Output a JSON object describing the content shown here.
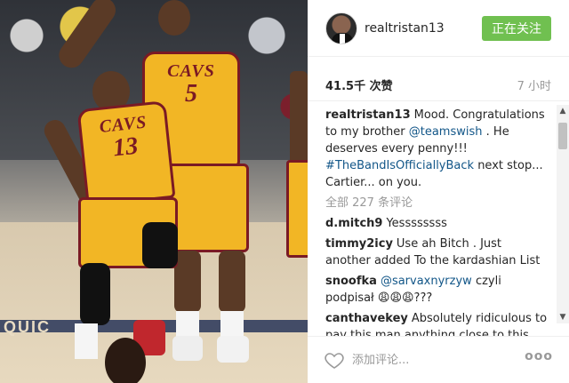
{
  "post": {
    "username": "realtristan13",
    "follow_label": "正在关注",
    "likes": "41.5千 次赞",
    "time": "7 小时"
  },
  "photo": {
    "jersey_left": {
      "team": "CAVS",
      "number": "13"
    },
    "jersey_right": {
      "team": "CAVS",
      "number": "5"
    },
    "court_text": "QUIC"
  },
  "caption": {
    "author": "realtristan13",
    "text_1": "Mood. Congratulations to my brother ",
    "mention": "@teamswish",
    "text_2": " . He deserves every penny!!! ",
    "hashtag": "#TheBandIsOfficiallyBack",
    "text_3": " next stop... Cartier... on you."
  },
  "comments_header": "全部 227 条评论",
  "comments": [
    {
      "author": "d.mitch9",
      "text": "Yessssssss"
    },
    {
      "author": "timmy2icy",
      "text": "Use ah Bitch . Just another added To the kardashian List"
    },
    {
      "author": "snoofka",
      "mention": "@sarvaxnyrzyw",
      "text": " czyli podpisał 😩😩😩???"
    },
    {
      "author": "canthavekey",
      "text": "Absolutely ridiculous to pay this man anything close to this amount. Weak minded and undisciplined and incredibly inconsistent. The NBA"
    }
  ],
  "footer": {
    "add_comment_placeholder": "添加评论...",
    "more_label": "ooo"
  },
  "icons": {
    "heart": "heart-outline-icon",
    "more": "more-options-icon"
  },
  "colors": {
    "follow_green": "#70c050",
    "link_blue": "#125688",
    "muted_gray": "#999999",
    "cavs_gold": "#f2b625",
    "cavs_wine": "#7a1a24"
  }
}
